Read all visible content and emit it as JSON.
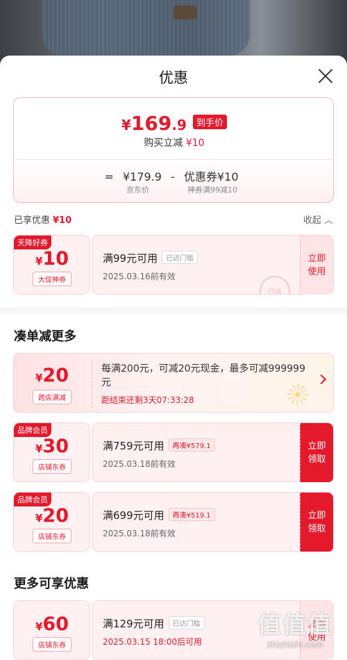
{
  "sheet": {
    "title": "优惠"
  },
  "summary": {
    "yen": "¥",
    "price": "169.9",
    "price_suffix": ".9",
    "tag": "到手价",
    "sub_text": "购买立减",
    "sub_amount": "¥10",
    "eq": "=",
    "jd_price": "¥179.9",
    "minus": "-",
    "coupon_text": "优惠券¥10",
    "jd_label": "京东价",
    "coupon_label": "神券满99减10"
  },
  "enjoyed": {
    "label": "已享优惠",
    "amount": "¥10",
    "collapse": "收起"
  },
  "used_coupon": {
    "corner": "天降好券",
    "yen": "¥",
    "value": "10",
    "type": "大促神券",
    "condition": "满99元可用",
    "pill": "已达门槛",
    "date": "2025.03.16前有效",
    "button": "立即使用",
    "stamp": "已选"
  },
  "section1": {
    "title": "凑单减更多"
  },
  "promo": {
    "yen": "¥",
    "value": "20",
    "type": "跨店满减",
    "desc": "每满200元，可减20元现金，最多可减999999元",
    "countdown": "距结束还剩3天07:33:28"
  },
  "coupons": [
    {
      "corner": "品牌会员",
      "yen": "¥",
      "value": "30",
      "type": "店铺东券",
      "condition": "满759元可用",
      "pill": "再凑¥579.1",
      "date": "2025.03.18前有效",
      "button": "立即领取"
    },
    {
      "corner": "品牌会员",
      "yen": "¥",
      "value": "20",
      "type": "店铺东券",
      "condition": "满699元可用",
      "pill": "再凑¥519.1",
      "date": "2025.03.18前有效",
      "button": "立即领取"
    }
  ],
  "section2": {
    "title": "更多可享优惠"
  },
  "more_coupon": {
    "yen": "¥",
    "value": "60",
    "type": "店铺东券",
    "condition": "满129元可用",
    "pill": "已达门槛",
    "date": "2025.03.15  18:00后可用",
    "button": "立即使用"
  },
  "watermark": {
    "logo": "值值值",
    "url": "zhizhizhi.com"
  },
  "colors": {
    "accent": "#e4192c",
    "pink_bg": "#fff0f2"
  }
}
